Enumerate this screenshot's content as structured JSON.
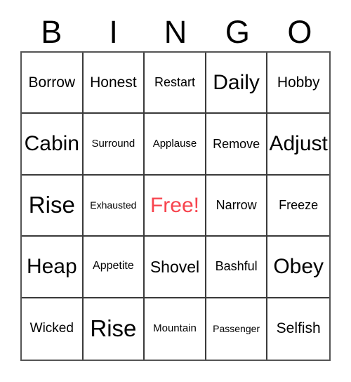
{
  "card": {
    "title": "BINGO",
    "header_letters": [
      "B",
      "I",
      "N",
      "G",
      "O"
    ],
    "free_color": "#f7444e",
    "grid_line_color": "#3a3a3a",
    "border_color": "#555555",
    "columns": 5,
    "rows": 5,
    "cells": [
      {
        "text": "Borrow",
        "size": "fs-l",
        "free": false
      },
      {
        "text": "Honest",
        "size": "fs-l",
        "free": false
      },
      {
        "text": "Restart",
        "size": "fs-m",
        "free": false
      },
      {
        "text": "Daily",
        "size": "fs-xxl",
        "free": false
      },
      {
        "text": "Hobby",
        "size": "fs-l",
        "free": false
      },
      {
        "text": "Cabin",
        "size": "fs-xxl",
        "free": false
      },
      {
        "text": "Surround",
        "size": "fs-s",
        "free": false
      },
      {
        "text": "Applause",
        "size": "fs-s",
        "free": false
      },
      {
        "text": "Remove",
        "size": "fs-m",
        "free": false
      },
      {
        "text": "Adjust",
        "size": "fs-xxl",
        "free": false
      },
      {
        "text": "Rise",
        "size": "fs-huge",
        "free": false
      },
      {
        "text": "Exhausted",
        "size": "fs-xs",
        "free": false
      },
      {
        "text": "Free!",
        "size": "fs-xxl",
        "free": true
      },
      {
        "text": "Narrow",
        "size": "fs-m",
        "free": false
      },
      {
        "text": "Freeze",
        "size": "fs-m",
        "free": false
      },
      {
        "text": "Heap",
        "size": "fs-xxl",
        "free": false
      },
      {
        "text": "Appetite",
        "size": "fs-sm",
        "free": false
      },
      {
        "text": "Shovel",
        "size": "fs-xl",
        "free": false
      },
      {
        "text": "Bashful",
        "size": "fs-m",
        "free": false
      },
      {
        "text": "Obey",
        "size": "fs-xxl",
        "free": false
      },
      {
        "text": "Wicked",
        "size": "fs-ml",
        "free": false
      },
      {
        "text": "Rise",
        "size": "fs-huge",
        "free": false
      },
      {
        "text": "Mountain",
        "size": "fs-s",
        "free": false
      },
      {
        "text": "Passenger",
        "size": "fs-xs",
        "free": false
      },
      {
        "text": "Selfish",
        "size": "fs-l",
        "free": false
      }
    ]
  }
}
